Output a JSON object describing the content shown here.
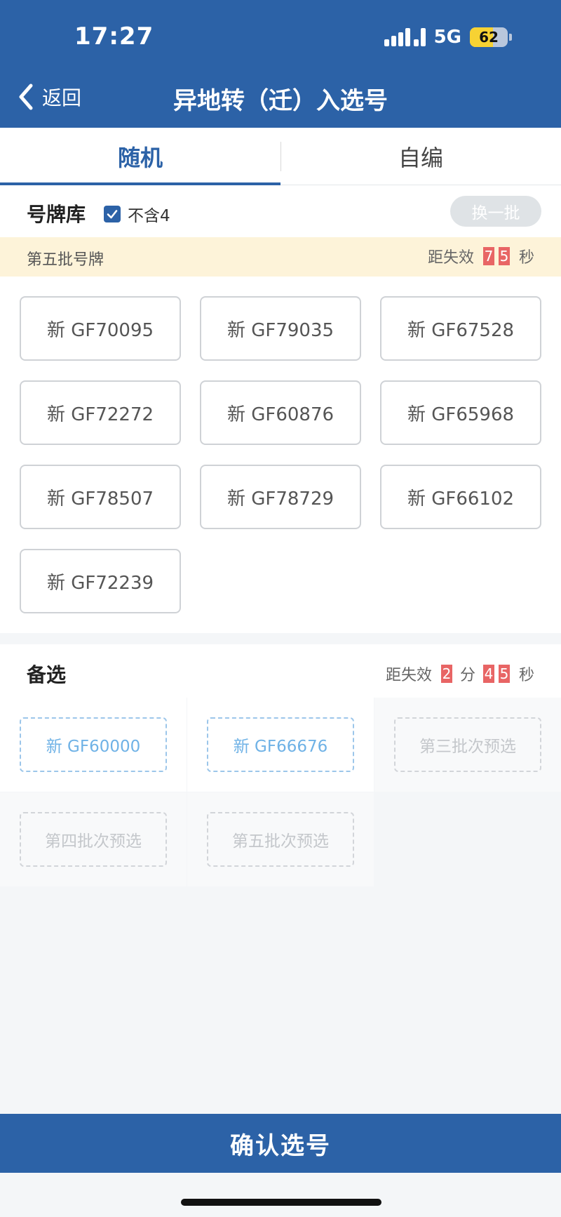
{
  "status_bar": {
    "time": "17:27",
    "network": "5G",
    "battery": "62",
    "battery_level": 0.62
  },
  "nav": {
    "back_label": "返回",
    "title": "异地转（迁）入选号"
  },
  "tabs": [
    {
      "label": "随机",
      "active": true
    },
    {
      "label": "自编",
      "active": false
    }
  ],
  "pool": {
    "title": "号牌库",
    "exclude_label": "不含4",
    "exclude_checked": true,
    "refresh_label": "换一批"
  },
  "batch": {
    "title": "第五批号牌",
    "countdown_prefix": "距失效",
    "seconds": [
      "7",
      "5"
    ],
    "seconds_unit": "秒"
  },
  "plates": [
    "新 GF70095",
    "新 GF79035",
    "新 GF67528",
    "新 GF72272",
    "新 GF60876",
    "新 GF65968",
    "新 GF78507",
    "新 GF78729",
    "新 GF66102",
    "新 GF72239"
  ],
  "alternates": {
    "title": "备选",
    "countdown_prefix": "距失效",
    "minutes": [
      "2"
    ],
    "minutes_unit": "分",
    "seconds": [
      "4",
      "5"
    ],
    "seconds_unit": "秒",
    "slots": [
      {
        "label": "新 GF60000",
        "filled": true
      },
      {
        "label": "新 GF66676",
        "filled": true
      },
      {
        "label": "第三批次预选",
        "filled": false
      },
      {
        "label": "第四批次预选",
        "filled": false
      },
      {
        "label": "第五批次预选",
        "filled": false
      }
    ]
  },
  "confirm_label": "确认选号",
  "colors": {
    "primary": "#2c62a7",
    "countdown_digit": "#e86565",
    "batch_banner": "#fdf3d9",
    "selected_slot": "#6fb2e6",
    "battery": "#f7d233"
  },
  "icons": {
    "back": "chevron-left-icon",
    "signal": "cellular-signal-icon",
    "battery": "battery-icon",
    "checkbox": "checkmark-icon"
  }
}
